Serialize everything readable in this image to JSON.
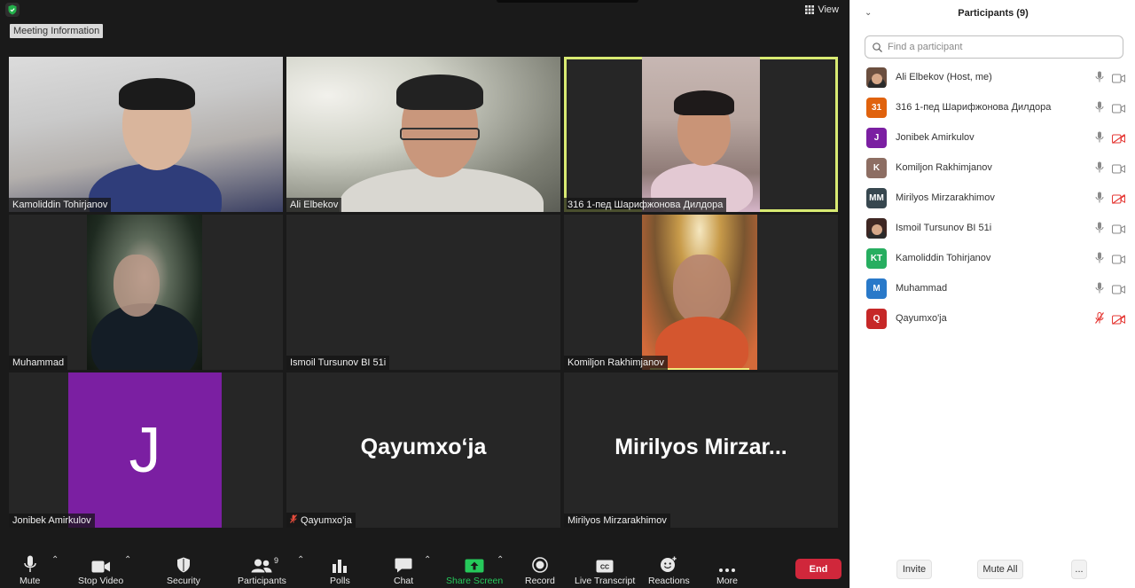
{
  "top": {
    "view_label": "View",
    "meeting_info_label": "Meeting Information"
  },
  "tiles": [
    {
      "name": "Kamoliddin Tohirjanov"
    },
    {
      "name": "Ali Elbekov"
    },
    {
      "name": "316 1-пед Шарифжонова Дилдора"
    },
    {
      "name": "Muhammad"
    },
    {
      "name": "Ismoil Tursunov BI 51i"
    },
    {
      "name": "Komiljon Rakhimjanov"
    },
    {
      "name": "Jonibek Amirkulov",
      "avatar_letter": "J",
      "avatar_color": "#7b1fa2"
    },
    {
      "name": "Qayumxo'ja",
      "big_name": "Qayumxo‘ja",
      "muted": true
    },
    {
      "name": "Mirilyos Mirzarakhimov",
      "big_name": "Mirilyos  Mirzar..."
    }
  ],
  "toolbar": {
    "mute": "Mute",
    "stop_video": "Stop Video",
    "security": "Security",
    "participants": "Participants",
    "participants_count": "9",
    "polls": "Polls",
    "chat": "Chat",
    "share_screen": "Share Screen",
    "record": "Record",
    "live_transcript": "Live Transcript",
    "reactions": "Reactions",
    "more": "More",
    "end": "End"
  },
  "panel": {
    "title": "Participants (9)",
    "search_placeholder": "Find a participant",
    "invite": "Invite",
    "mute_all": "Mute All",
    "more": "...",
    "participants": [
      {
        "name": "Ali Elbekov (Host, me)",
        "initials": "",
        "color": "#6b4f3f",
        "mic_muted": false,
        "cam_off": false
      },
      {
        "name": "316 1-пед Шарифжонова Дилдора",
        "initials": "31",
        "color": "#e0620d",
        "mic_muted": false,
        "cam_off": false
      },
      {
        "name": "Jonibek Amirkulov",
        "initials": "J",
        "color": "#7b1fa2",
        "mic_muted": false,
        "cam_off": true
      },
      {
        "name": "Komiljon Rakhimjanov",
        "initials": "K",
        "color": "#8d6e63",
        "mic_muted": false,
        "cam_off": false
      },
      {
        "name": "Mirilyos Mirzarakhimov",
        "initials": "MM",
        "color": "#37474f",
        "mic_muted": false,
        "cam_off": true
      },
      {
        "name": "Ismoil Tursunov BI 51i",
        "initials": "",
        "color": "#3e2723",
        "mic_muted": false,
        "cam_off": false
      },
      {
        "name": "Kamoliddin Tohirjanov",
        "initials": "KT",
        "color": "#27ae60",
        "mic_muted": false,
        "cam_off": false
      },
      {
        "name": "Muhammad",
        "initials": "M",
        "color": "#2979c9",
        "mic_muted": false,
        "cam_off": false
      },
      {
        "name": "Qayumxo'ja",
        "initials": "Q",
        "color": "#c62828",
        "mic_muted": true,
        "cam_off": true
      }
    ]
  }
}
